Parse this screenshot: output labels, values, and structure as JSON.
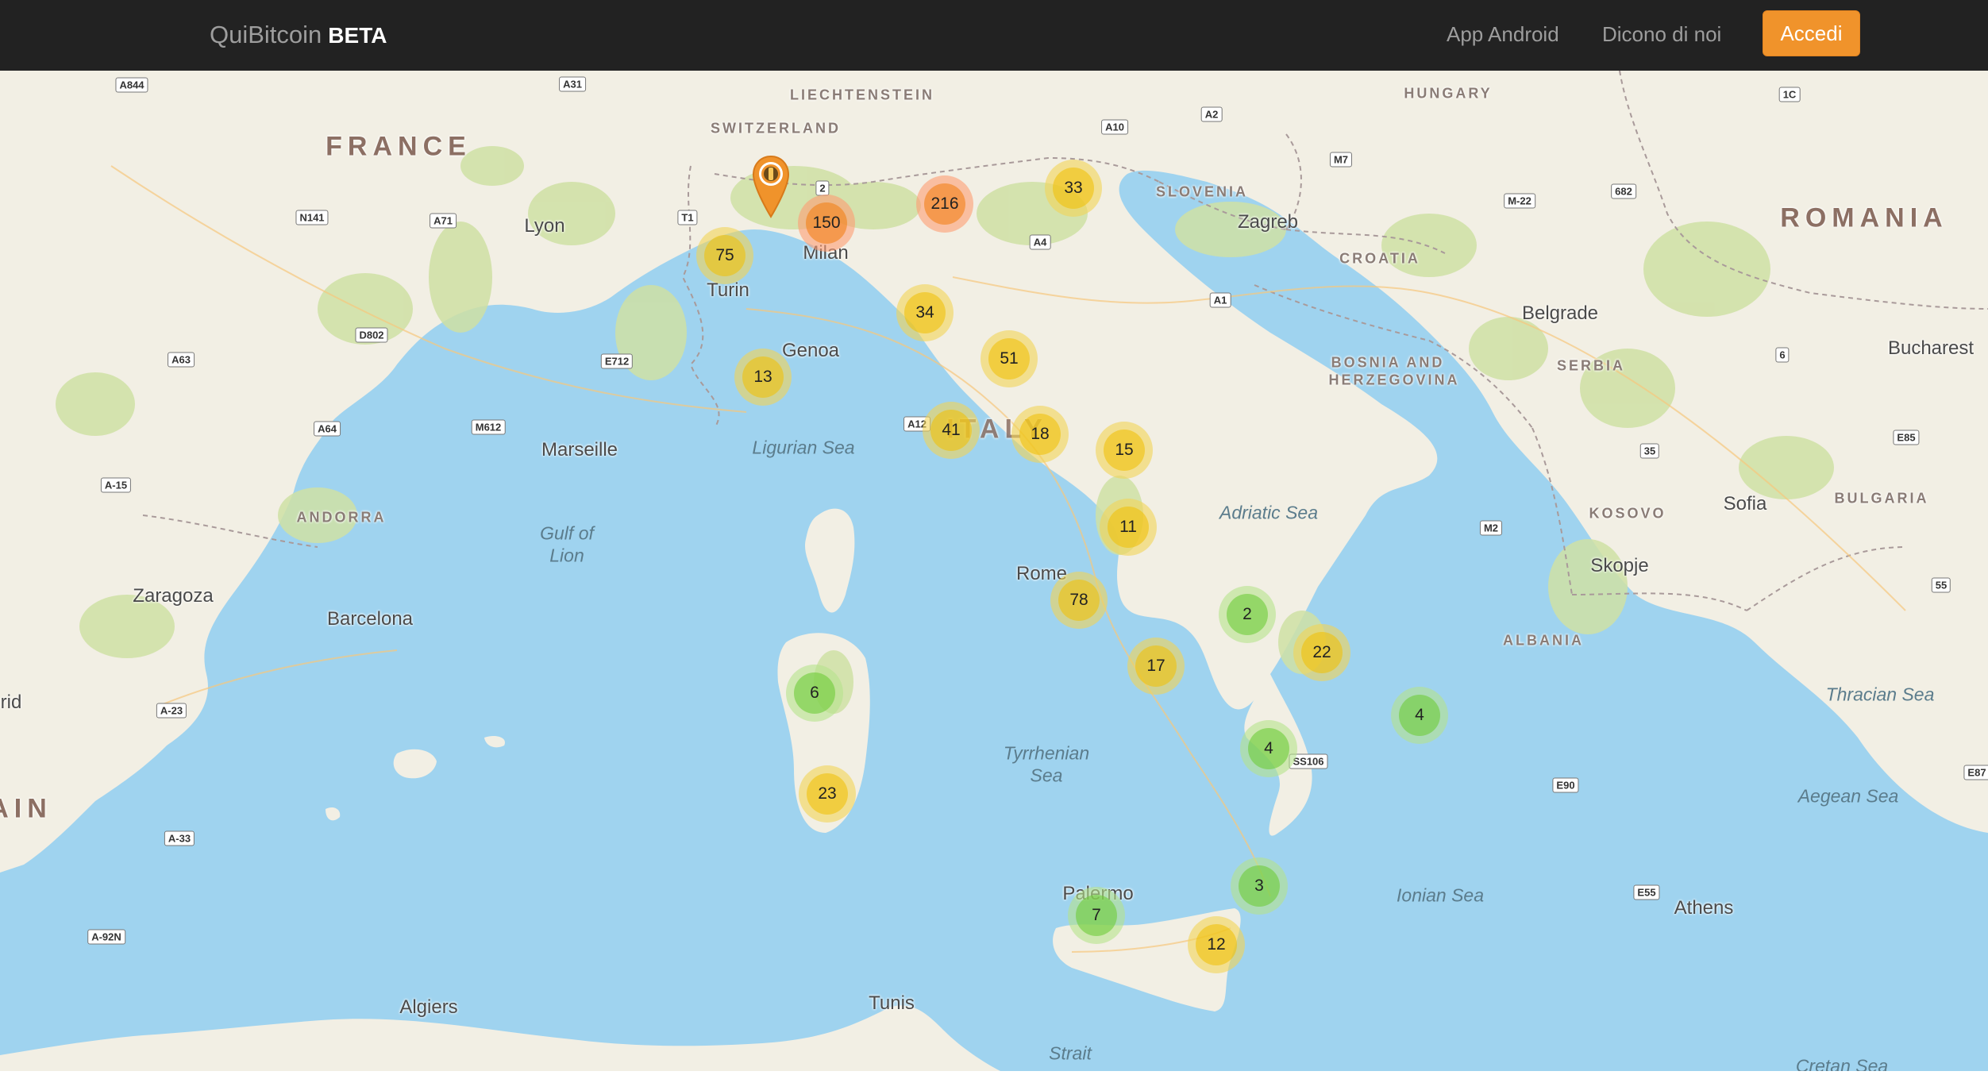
{
  "navbar": {
    "brand": "QuiBitcoin",
    "brand_badge": "BETA",
    "links": [
      "App Android",
      "Dicono di noi"
    ],
    "login_label": "Accedi",
    "accent_color": "#f0932b"
  },
  "map": {
    "countries": [
      "FRANCE",
      "ROMANIA",
      "HUNGARY",
      "SLOVENIA",
      "CROATIA",
      "BOSNIA AND",
      "HERZEGOVINA",
      "SERBIA",
      "KOSOVO",
      "ALBANIA",
      "BULGARIA",
      "ANDORRA",
      "LIECHTENSTEIN",
      "SWITZERLAND",
      "ITALY",
      "AIN"
    ],
    "cities": [
      "Lyon",
      "Turin",
      "Milan",
      "Genoa",
      "Marseille",
      "Zaragoza",
      "Barcelona",
      "Rome",
      "Zagreb",
      "Belgrade",
      "Bucharest",
      "Sofia",
      "Skopje",
      "Athens",
      "Palermo",
      "Algiers",
      "Tunis",
      "rid"
    ],
    "seas": [
      "Ligurian Sea",
      "Gulf of",
      "Lion",
      "Adriatic Sea",
      "Tyrrhenian",
      "Sea",
      "Ionian Sea",
      "Thracian Sea",
      "Aegean Sea",
      "Strait",
      "Cretan Sea"
    ],
    "road_shields": [
      "A844",
      "A31",
      "A10",
      "A2",
      "M7",
      "1C",
      "N141",
      "A71",
      "T1",
      "2",
      "A4",
      "M-22",
      "682",
      "D802",
      "A63",
      "E712",
      "A1",
      "6",
      "A64",
      "M612",
      "A12",
      "35",
      "E85",
      "A-15",
      "M2",
      "55",
      "A-23",
      "A-33",
      "SS106",
      "E90",
      "E87",
      "E55",
      "A-92N"
    ],
    "clusters": [
      {
        "count": "150",
        "level": "o"
      },
      {
        "count": "216",
        "level": "o"
      },
      {
        "count": "33",
        "level": "y"
      },
      {
        "count": "75",
        "level": "y"
      },
      {
        "count": "34",
        "level": "y"
      },
      {
        "count": "51",
        "level": "y"
      },
      {
        "count": "13",
        "level": "y"
      },
      {
        "count": "41",
        "level": "y"
      },
      {
        "count": "18",
        "level": "y"
      },
      {
        "count": "15",
        "level": "y"
      },
      {
        "count": "11",
        "level": "y"
      },
      {
        "count": "78",
        "level": "y"
      },
      {
        "count": "2",
        "level": "g"
      },
      {
        "count": "22",
        "level": "y"
      },
      {
        "count": "17",
        "level": "y"
      },
      {
        "count": "6",
        "level": "g"
      },
      {
        "count": "4",
        "level": "g"
      },
      {
        "count": "4",
        "level": "g"
      },
      {
        "count": "23",
        "level": "y"
      },
      {
        "count": "3",
        "level": "g"
      },
      {
        "count": "7",
        "level": "g"
      },
      {
        "count": "12",
        "level": "y"
      }
    ],
    "marker_icon": "bitcoin-location-pin-icon",
    "water_color": "#9fd3ef",
    "land_color": "#f2efe4"
  }
}
